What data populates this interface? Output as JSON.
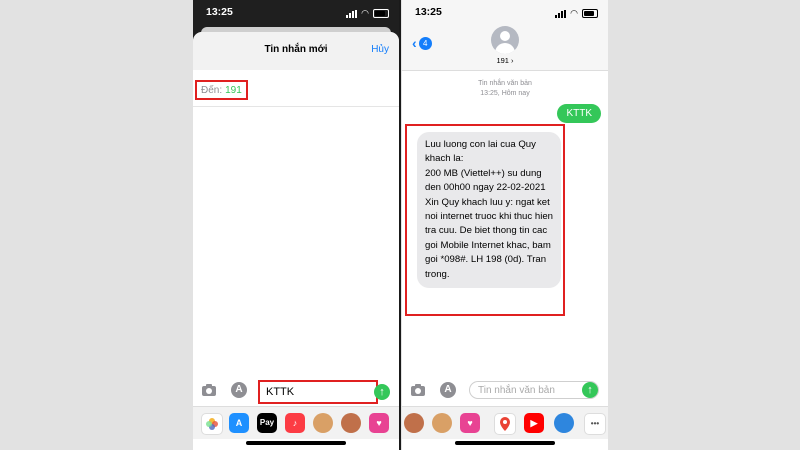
{
  "left_phone": {
    "status_time": "13:25",
    "sheet_title": "Tin nhắn mới",
    "cancel_label": "Hủy",
    "to_label": "Đến:",
    "to_value": "191",
    "message_input_value": "KTTK",
    "send_icon": "arrow-up-icon",
    "camera_icon": "camera-icon",
    "apps_icon": "app-store-icon",
    "dock_apps": [
      "Photos",
      "App Store",
      "Apple Pay",
      "Music",
      "Memoji",
      "Memoji",
      "Heart stickers",
      "Memoji"
    ],
    "dock_apple_pay_label": "Pay",
    "dock_app_store_label": "A"
  },
  "right_phone": {
    "status_time": "13:25",
    "back_badge": "4",
    "contact_name": "191 ›",
    "meta_type": "Tin nhắn văn bản",
    "meta_time": "13:25, Hôm nay",
    "outgoing_message": "KTTK",
    "incoming_message": "Luu luong con lai cua Quy khach la:\n200 MB (Viettel++) su dung den 00h00 ngay 22-02-2021\nXin Quy khach luu y: ngat ket noi internet truoc khi thuc hien tra cuu. De biet thong tin cac goi Mobile Internet khac, bam goi *098#. LH 198 (0d). Tran trong.",
    "input_placeholder": "Tin nhắn văn bản",
    "dock_apps": [
      "Memoji",
      "Memoji",
      "Heart stickers",
      "Google Maps",
      "YouTube",
      "Memoji",
      "Clips",
      "More"
    ],
    "dock_more_label": "•••"
  },
  "colors": {
    "ios_blue": "#147efb",
    "imessage_green": "#34c759",
    "highlight_red": "#e02020",
    "bubble_gray": "#e9e9eb"
  }
}
